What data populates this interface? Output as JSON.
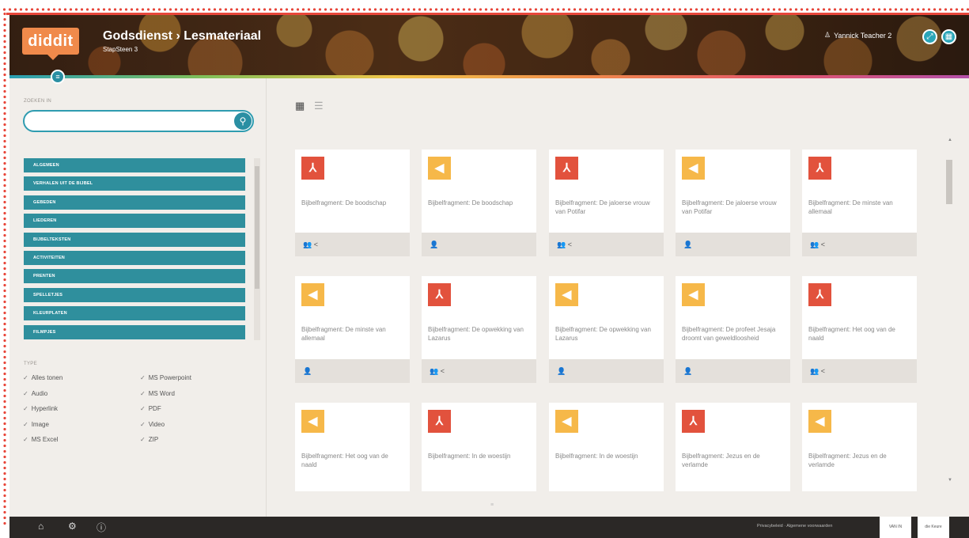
{
  "header": {
    "logo_text": "diddit",
    "title": "Godsdienst › Lesmateriaal",
    "subtitle": "StapSteen 3",
    "user_name": "Yannick Teacher 2",
    "user_icon": "user-icon",
    "buttons": [
      "expand-icon",
      "grid-icon"
    ]
  },
  "sidebar": {
    "search_label": "ZOEKEN IN",
    "search_value": "",
    "categories": [
      "ALGEMEEN",
      "VERHALEN UIT DE BIJBEL",
      "GEBEDEN",
      "LIEDEREN",
      "BIJBELTEKSTEN",
      "ACTIVITEITEN",
      "PRENTEN",
      "SPELLETJES",
      "KLEURPLATEN",
      "FILMPJES"
    ],
    "type_label": "TYPE",
    "types_left": [
      "Alles tonen",
      "Audio",
      "Hyperlink",
      "Image",
      "MS Excel"
    ],
    "types_right": [
      "MS Powerpoint",
      "MS Word",
      "PDF",
      "Video",
      "ZIP"
    ]
  },
  "main": {
    "cards": [
      {
        "type": "pdf",
        "title": "Bijbelfragment: De boodschap",
        "footer": "👥 <"
      },
      {
        "type": "audio",
        "title": "Bijbelfragment: De boodschap",
        "footer": "👤"
      },
      {
        "type": "pdf",
        "title": "Bijbelfragment: De jaloerse vrouw van Potifar",
        "footer": "👥 <"
      },
      {
        "type": "audio",
        "title": "Bijbelfragment: De jaloerse vrouw van Potifar",
        "footer": "👤"
      },
      {
        "type": "pdf",
        "title": "Bijbelfragment: De minste van allemaal",
        "footer": "👥 <"
      },
      {
        "type": "audio",
        "title": "Bijbelfragment: De minste van allemaal",
        "footer": "👤"
      },
      {
        "type": "pdf",
        "title": "Bijbelfragment: De opwekking van Lazarus",
        "footer": "👥 <"
      },
      {
        "type": "audio",
        "title": "Bijbelfragment: De opwekking van Lazarus",
        "footer": "👤"
      },
      {
        "type": "audio",
        "title": "Bijbelfragment: De profeet Jesaja droomt van geweldloosheid",
        "footer": "👤"
      },
      {
        "type": "pdf",
        "title": "Bijbelfragment: Het oog van de naald",
        "footer": "👥 <"
      },
      {
        "type": "audio",
        "title": "Bijbelfragment: Het oog van de naald",
        "footer": ""
      },
      {
        "type": "pdf",
        "title": "Bijbelfragment: In de woestijn",
        "footer": ""
      },
      {
        "type": "audio",
        "title": "Bijbelfragment: In de woestijn",
        "footer": ""
      },
      {
        "type": "pdf",
        "title": "Bijbelfragment: Jezus en de verlamde",
        "footer": ""
      },
      {
        "type": "audio",
        "title": "Bijbelfragment: Jezus en de verlamde",
        "footer": ""
      }
    ]
  },
  "footer": {
    "links": "Privacybeleid · Algemene voorwaarden",
    "box1": "VAN IN",
    "box2": "die Keure"
  }
}
